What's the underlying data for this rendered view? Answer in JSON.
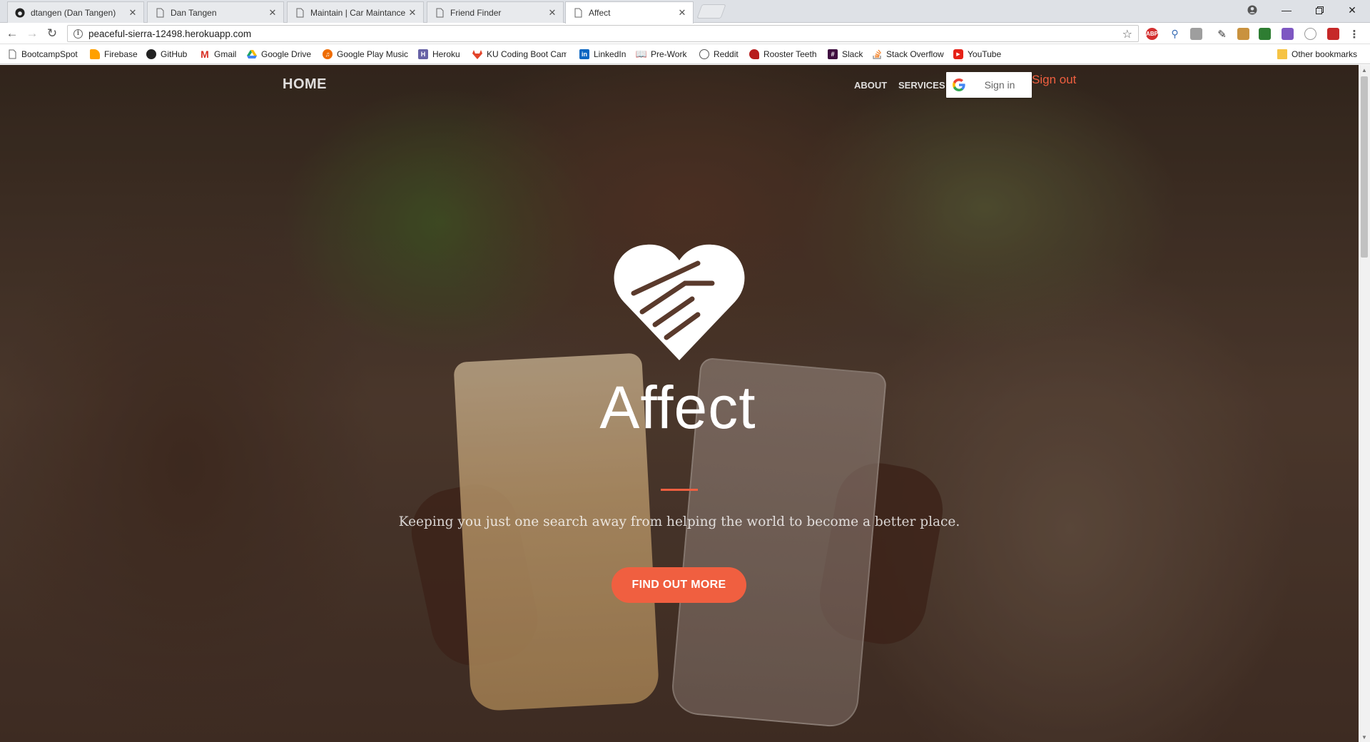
{
  "browser": {
    "tabs": [
      {
        "title": "dtangen (Dan Tangen)",
        "icon": "github-icon"
      },
      {
        "title": "Dan Tangen",
        "icon": "page-icon"
      },
      {
        "title": "Maintain | Car Maintance",
        "icon": "page-icon"
      },
      {
        "title": "Friend Finder",
        "icon": "page-icon"
      },
      {
        "title": "Affect",
        "icon": "page-icon",
        "active": true
      }
    ],
    "url": "peaceful-sierra-12498.herokuapp.com",
    "bookmarks": [
      {
        "label": "BootcampSpot",
        "icon": "page-icon"
      },
      {
        "label": "Firebase",
        "icon": "firebase-icon"
      },
      {
        "label": "GitHub",
        "icon": "github-icon"
      },
      {
        "label": "Gmail",
        "icon": "gmail-icon"
      },
      {
        "label": "Google Drive",
        "icon": "drive-icon"
      },
      {
        "label": "Google Play Music",
        "icon": "play-music-icon"
      },
      {
        "label": "Heroku",
        "icon": "heroku-icon"
      },
      {
        "label": "KU Coding Boot Cam",
        "icon": "gitlab-icon"
      },
      {
        "label": "LinkedIn",
        "icon": "linkedin-icon"
      },
      {
        "label": "Pre-Work",
        "icon": "book-icon"
      },
      {
        "label": "Reddit",
        "icon": "reddit-icon"
      },
      {
        "label": "Rooster Teeth",
        "icon": "rooster-teeth-icon"
      },
      {
        "label": "Slack",
        "icon": "slack-icon"
      },
      {
        "label": "Stack Overflow",
        "icon": "stackoverflow-icon"
      },
      {
        "label": "YouTube",
        "icon": "youtube-icon"
      }
    ],
    "other_bookmarks": "Other bookmarks"
  },
  "site": {
    "nav": {
      "home": "HOME",
      "about": "ABOUT",
      "services": "SERVICES",
      "sign_in": "Sign in",
      "sign_out": "Sign out"
    },
    "hero": {
      "brand": "Affect",
      "tagline": "Keeping you just one search away from helping the world to become a better place.",
      "cta": "FIND OUT MORE"
    },
    "colors": {
      "accent": "#f05f40",
      "text": "#ffffff"
    }
  }
}
